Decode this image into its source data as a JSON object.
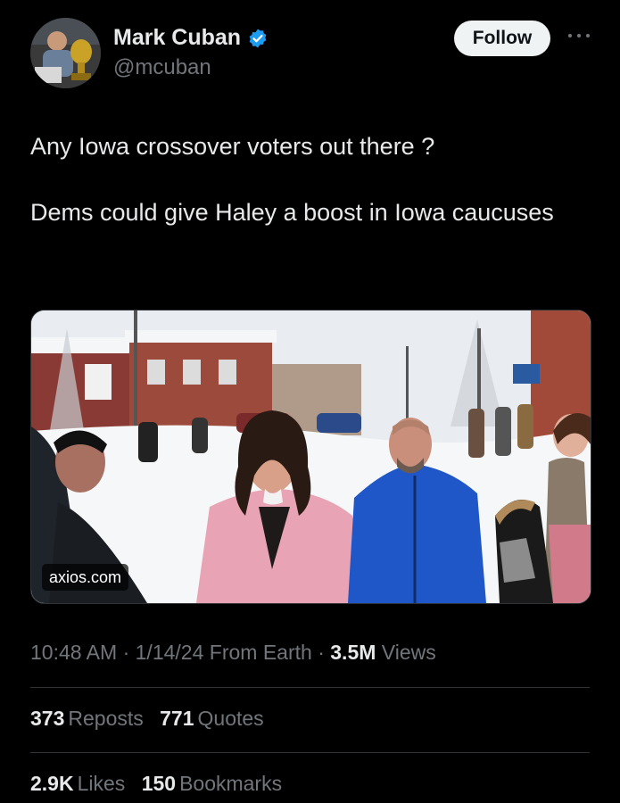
{
  "author": {
    "display_name": "Mark Cuban",
    "handle": "@mcuban",
    "verified_color": "#1d9bf0"
  },
  "actions": {
    "follow_label": "Follow",
    "more_icon": "more-horizontal-icon"
  },
  "tweet": {
    "paragraphs": [
      "Any Iowa crossover voters out there ?",
      "Dems could give Haley a boost in Iowa caucuses"
    ]
  },
  "media": {
    "link_label": "axios.com"
  },
  "meta": {
    "time": "10:48 AM",
    "sep1": " · ",
    "date": "1/14/24",
    "source": " From Earth",
    "sep2": " · ",
    "views_count": "3.5M",
    "views_label": " Views"
  },
  "stats": {
    "reposts_count": "373",
    "reposts_label": "Reposts",
    "quotes_count": "771",
    "quotes_label": "Quotes",
    "likes_count": "2.9K",
    "likes_label": "Likes",
    "bookmarks_count": "150",
    "bookmarks_label": "Bookmarks"
  },
  "colors": {
    "background": "#000000",
    "text_primary": "#e7e9ea",
    "text_secondary": "#71767b",
    "divider": "#2f3336",
    "follow_bg": "#eff3f4"
  }
}
